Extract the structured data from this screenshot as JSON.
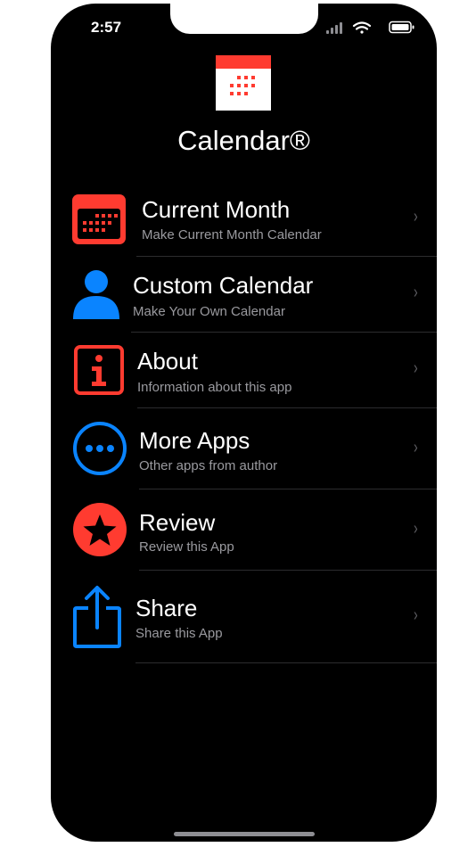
{
  "status_bar": {
    "time": "2:57",
    "icons": [
      "signal-icon",
      "wifi-icon",
      "battery-icon"
    ]
  },
  "app": {
    "title": "Calendar®",
    "icon": "calendar-icon"
  },
  "colors": {
    "red": "#FF3B30",
    "blue": "#0A84FF",
    "background": "#000000",
    "subtitle": "#9A9A9F"
  },
  "menu": [
    {
      "title": "Current Month",
      "subtitle": "Make Current Month Calendar",
      "icon": "calendar-icon"
    },
    {
      "title": "Custom Calendar",
      "subtitle": "Make Your Own Calendar",
      "icon": "person-icon"
    },
    {
      "title": "About",
      "subtitle": "Information about this app",
      "icon": "info-icon"
    },
    {
      "title": "More Apps",
      "subtitle": "Other apps from author",
      "icon": "more-icon"
    },
    {
      "title": "Review",
      "subtitle": "Review this App",
      "icon": "star-icon"
    },
    {
      "title": "Share",
      "subtitle": "Share this App",
      "icon": "share-icon"
    }
  ],
  "chevron": "›"
}
